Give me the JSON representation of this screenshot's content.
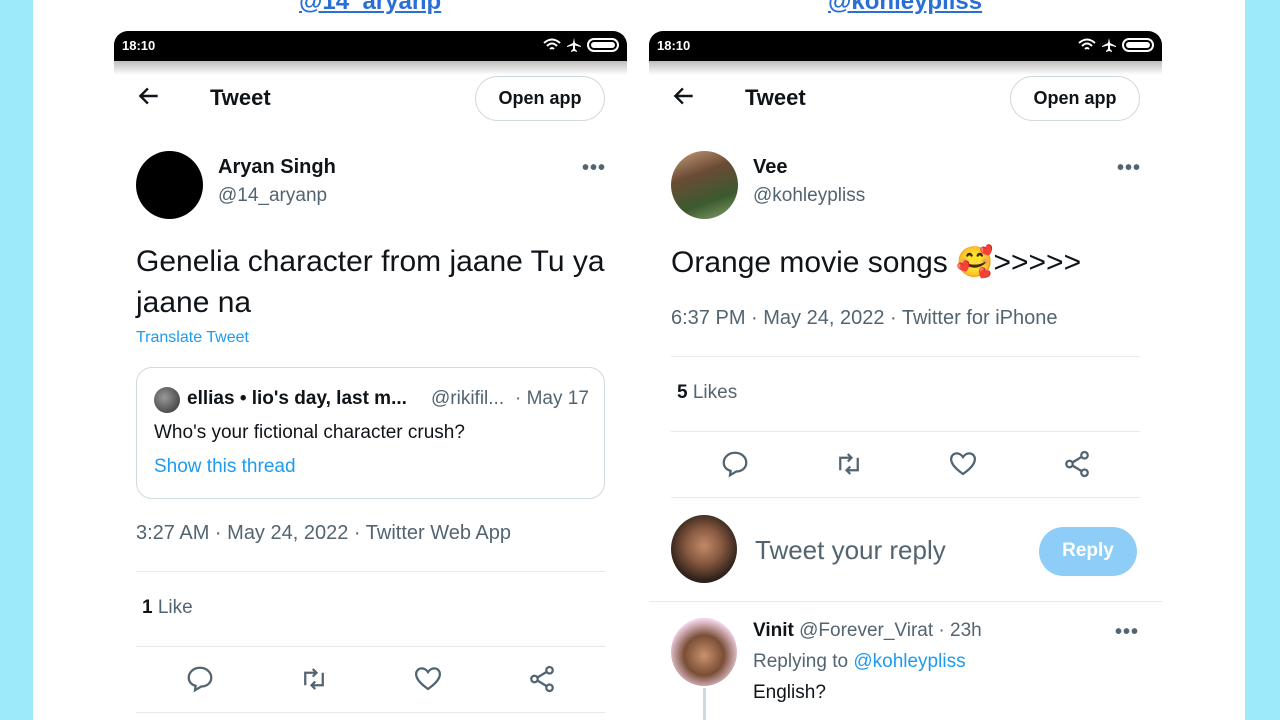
{
  "left": {
    "page_handle": "@14_aryanp",
    "status": {
      "time": "18:10"
    },
    "header": {
      "title": "Tweet",
      "open_app": "Open app"
    },
    "author": {
      "name": "Aryan Singh",
      "handle": "@14_aryanp"
    },
    "tweet_text": "Genelia character from jaane Tu ya jaane na",
    "translate": "Translate Tweet",
    "quote": {
      "name": "ellias • lio's day, last m...",
      "handle": "@rikifil...",
      "date": "· May 17",
      "text": "Who's your fictional character crush?",
      "link": "Show this thread"
    },
    "meta": "3:27 AM · May 24, 2022 · Twitter Web App",
    "likes": {
      "count": "1",
      "label": "Like"
    }
  },
  "right": {
    "page_handle": "@kohleypliss",
    "status": {
      "time": "18:10"
    },
    "header": {
      "title": "Tweet",
      "open_app": "Open app"
    },
    "author": {
      "name": "Vee",
      "handle": "@kohleypliss"
    },
    "tweet_text": "Orange movie songs 🥰>>>>>",
    "meta": "6:37 PM · May 24, 2022 · Twitter for iPhone",
    "likes": {
      "count": "5",
      "label": "Likes"
    },
    "reply": {
      "placeholder": "Tweet your reply",
      "button": "Reply"
    },
    "thread_reply": {
      "name": "Vinit",
      "handle_time": "@Forever_Virat · 23h",
      "replying_prefix": "Replying to",
      "replying_to": "@kohleypliss",
      "text": "English?"
    }
  },
  "more_icon": "more-horizontal-icon",
  "colors": {
    "background": "#9deafb",
    "accent": "#1d9bf0",
    "reply_button": "#8ecdf8",
    "secondary_text": "#536471"
  }
}
